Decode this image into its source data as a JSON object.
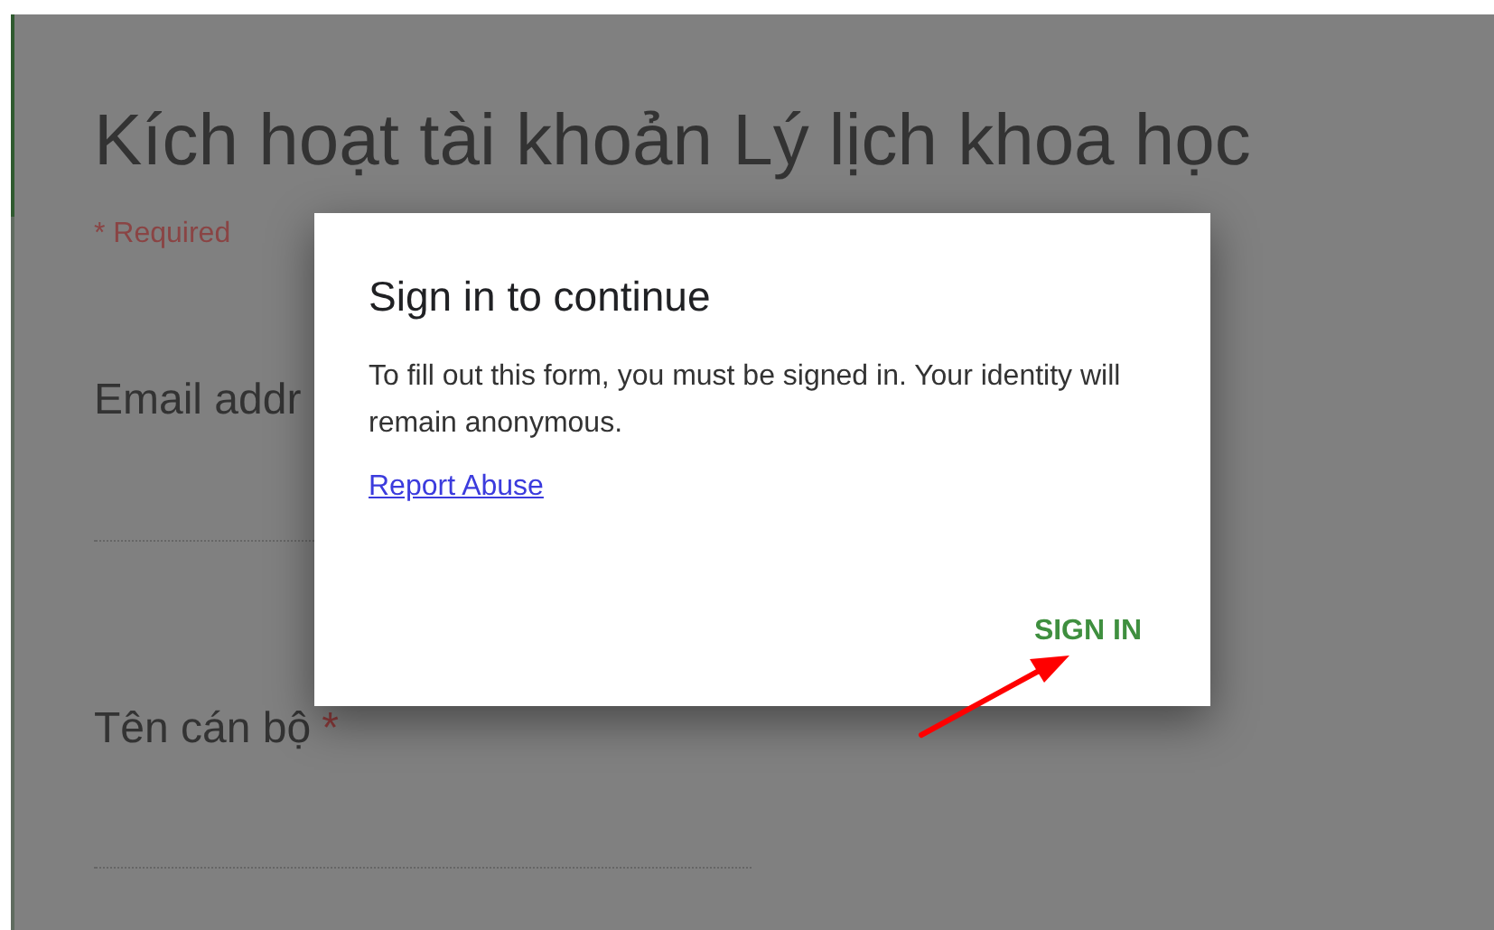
{
  "form": {
    "title": "Kích hoạt tài khoản Lý lịch khoa học",
    "required_note": "* Required",
    "fields": [
      {
        "label": "Email addr"
      },
      {
        "label": "Tên cán bộ",
        "required": true,
        "required_mark": "*"
      }
    ]
  },
  "dialog": {
    "title": "Sign in to continue",
    "message": "To fill out this form, you must be signed in. Your identity will remain anonymous.",
    "link": "Report Abuse",
    "button": "SIGN IN"
  }
}
